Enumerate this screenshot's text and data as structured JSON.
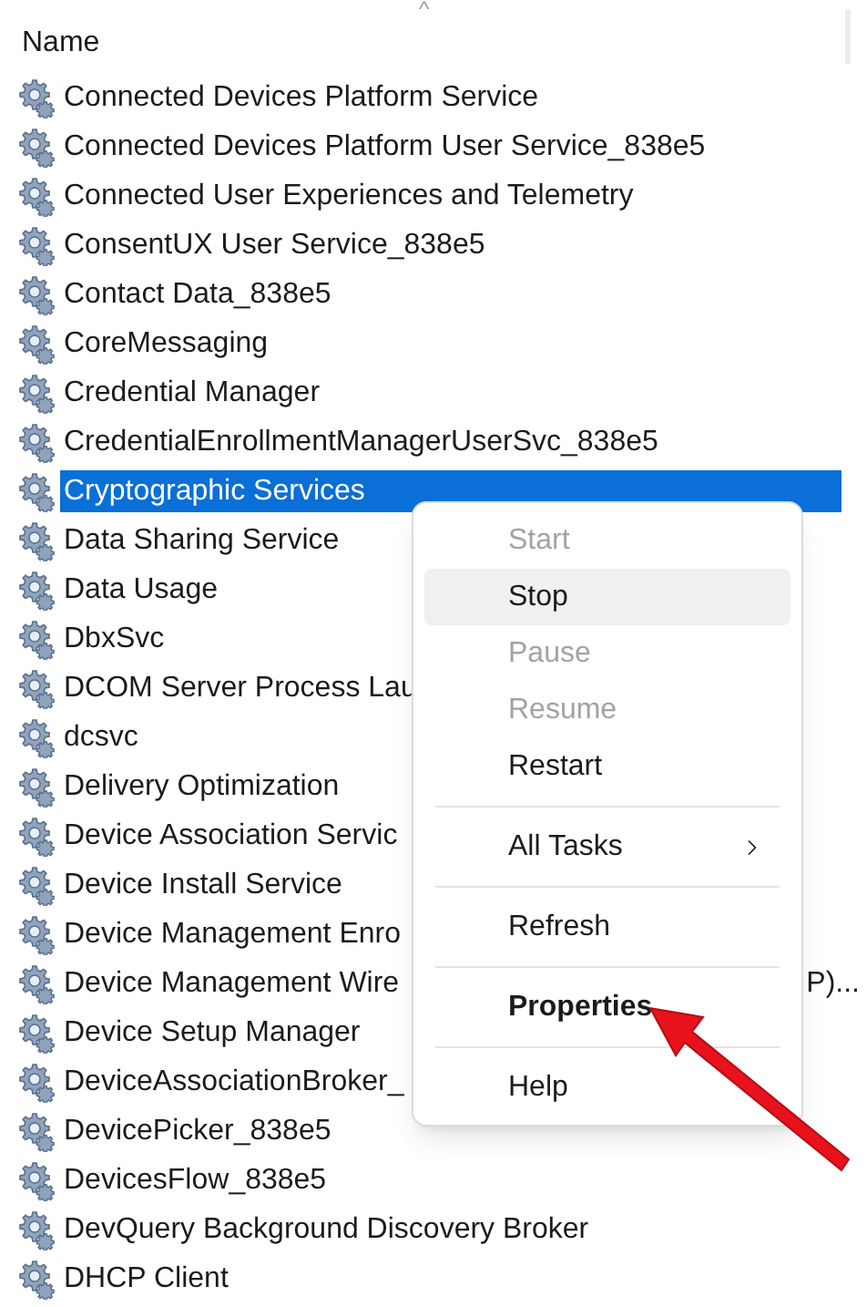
{
  "header": {
    "column": "Name",
    "sort_indicator": "^"
  },
  "rows": [
    {
      "name": "Connected Devices Platform Service",
      "selected": false
    },
    {
      "name": "Connected Devices Platform User Service_838e5",
      "selected": false
    },
    {
      "name": "Connected User Experiences and Telemetry",
      "selected": false
    },
    {
      "name": "ConsentUX User Service_838e5",
      "selected": false
    },
    {
      "name": "Contact Data_838e5",
      "selected": false
    },
    {
      "name": "CoreMessaging",
      "selected": false
    },
    {
      "name": "Credential Manager",
      "selected": false
    },
    {
      "name": "CredentialEnrollmentManagerUserSvc_838e5",
      "selected": false
    },
    {
      "name": "Cryptographic Services",
      "selected": true
    },
    {
      "name": "Data Sharing Service",
      "selected": false
    },
    {
      "name": "Data Usage",
      "selected": false
    },
    {
      "name": "DbxSvc",
      "selected": false
    },
    {
      "name": "DCOM Server Process Lau",
      "selected": false
    },
    {
      "name": "dcsvc",
      "selected": false
    },
    {
      "name": "Delivery Optimization",
      "selected": false
    },
    {
      "name": "Device Association Servic",
      "selected": false
    },
    {
      "name": "Device Install Service",
      "selected": false
    },
    {
      "name": "Device Management Enro",
      "selected": false
    },
    {
      "name": "Device Management Wire",
      "tail": "P)...",
      "selected": false
    },
    {
      "name": "Device Setup Manager",
      "selected": false
    },
    {
      "name": "DeviceAssociationBroker_",
      "selected": false
    },
    {
      "name": "DevicePicker_838e5",
      "selected": false
    },
    {
      "name": "DevicesFlow_838e5",
      "selected": false
    },
    {
      "name": "DevQuery Background Discovery Broker",
      "selected": false
    },
    {
      "name": "DHCP Client",
      "selected": false
    }
  ],
  "context_menu": [
    {
      "kind": "item",
      "label": "Start",
      "disabled": true,
      "hovered": false
    },
    {
      "kind": "item",
      "label": "Stop",
      "disabled": false,
      "hovered": true
    },
    {
      "kind": "item",
      "label": "Pause",
      "disabled": true,
      "hovered": false
    },
    {
      "kind": "item",
      "label": "Resume",
      "disabled": true,
      "hovered": false
    },
    {
      "kind": "item",
      "label": "Restart",
      "disabled": false,
      "hovered": false
    },
    {
      "kind": "separator"
    },
    {
      "kind": "item",
      "label": "All Tasks",
      "disabled": false,
      "hovered": false,
      "submenu": true
    },
    {
      "kind": "separator"
    },
    {
      "kind": "item",
      "label": "Refresh",
      "disabled": false,
      "hovered": false
    },
    {
      "kind": "separator"
    },
    {
      "kind": "item",
      "label": "Properties",
      "disabled": false,
      "hovered": false,
      "default": true
    },
    {
      "kind": "separator"
    },
    {
      "kind": "item",
      "label": "Help",
      "disabled": false,
      "hovered": false
    }
  ]
}
